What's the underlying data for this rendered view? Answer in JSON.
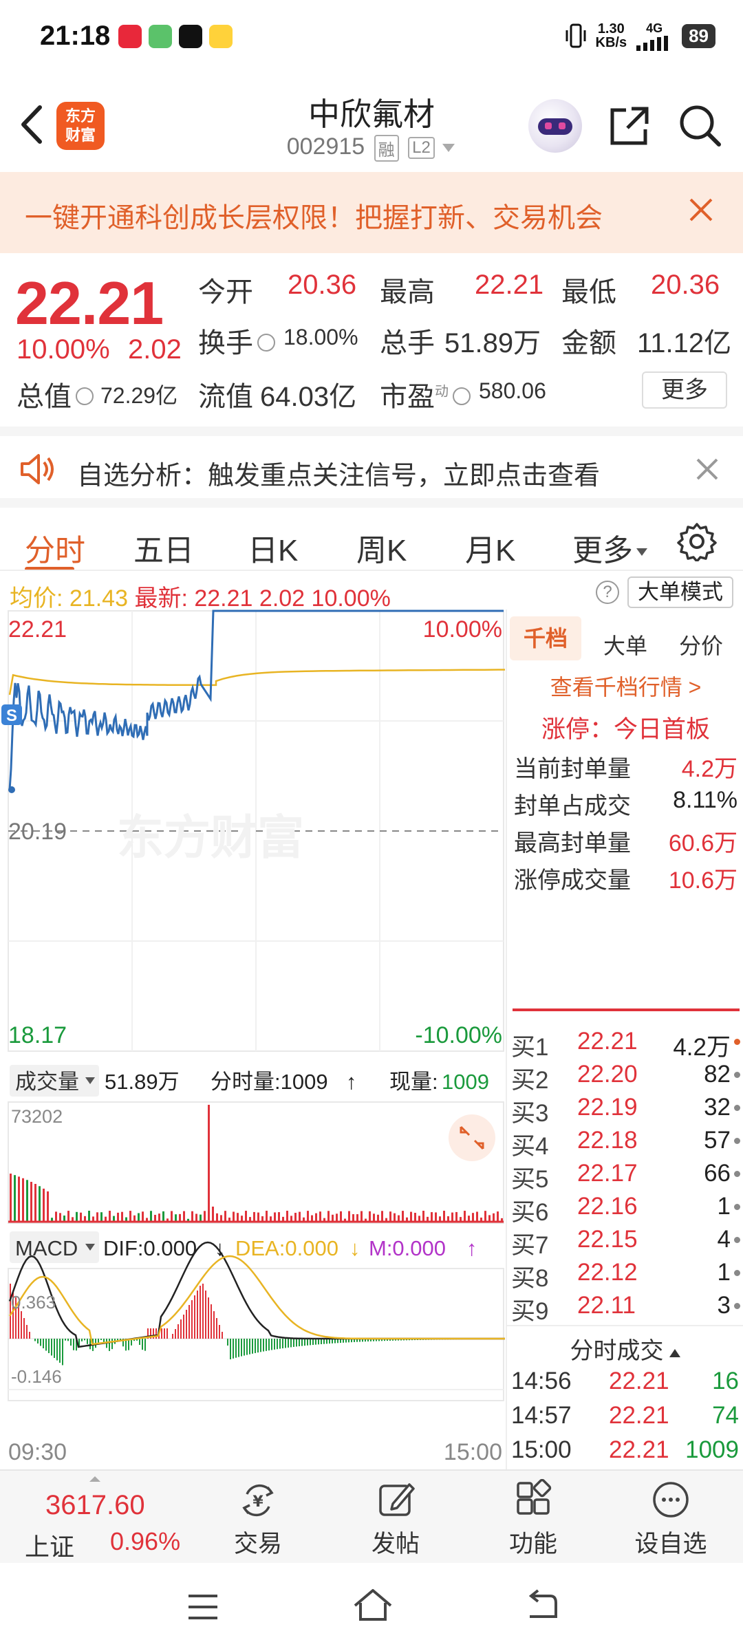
{
  "status_bar": {
    "time": "21:18",
    "net_speed_top": "1.30",
    "net_speed_unit": "KB/s",
    "net_type": "4G",
    "battery": "89"
  },
  "header": {
    "brand_line1": "东方",
    "brand_line2": "财富",
    "stock_name": "中欣氟材",
    "stock_code": "002915",
    "tag_margin": "融",
    "tag_level": "L2"
  },
  "promo": {
    "text": "一键开通科创成长层权限！把握打新、交易机会"
  },
  "quote": {
    "price": "22.21",
    "change_pct": "10.00%",
    "change_val": "2.02",
    "open_label": "今开",
    "open": "20.36",
    "high_label": "最高",
    "high": "22.21",
    "low_label": "最低",
    "low": "20.36",
    "turnover_label": "换手",
    "turnover": "18.00%",
    "volume_label": "总手",
    "volume": "51.89万",
    "amount_label": "金额",
    "amount": "11.12亿",
    "total_value_label": "总值",
    "total_value": "72.29亿",
    "float_value_label": "流值",
    "float_value": "64.03亿",
    "pe_label": "市盈",
    "pe_sup": "动",
    "pe": "580.06",
    "more": "更多"
  },
  "notice": {
    "text": "自选分析：触发重点关注信号，立即点击查看"
  },
  "tabs": [
    {
      "label": "分时"
    },
    {
      "label": "五日"
    },
    {
      "label": "日K"
    },
    {
      "label": "周K"
    },
    {
      "label": "月K"
    },
    {
      "label": "更多"
    }
  ],
  "avg_row": {
    "avg_label": "均价:",
    "avg_value": "21.43",
    "latest_label": "最新:",
    "latest_value": "22.21",
    "latest_change": "2.02",
    "latest_pct": "10.00%",
    "help": "?",
    "big_order_mode": "大单模式"
  },
  "chart": {
    "top_price": "22.21",
    "top_pct": "10.00%",
    "mid_price": "20.19",
    "bottom_price": "18.17",
    "bottom_pct": "-10.00%",
    "marker": "S",
    "watermark": "东方财富",
    "vol_selector": "成交量",
    "vol_total": "51.89万",
    "tick_vol_label": "分时量:1009",
    "tick_vol_arrow": "↑",
    "now_vol_label": "现量:",
    "now_vol": "1009",
    "vol_max": "73202",
    "macd_selector": "MACD",
    "dif": "DIF:0.000",
    "dif_arrow": "↓",
    "dea": "DEA:0.000",
    "dea_arrow": "↓",
    "m": "M:0.000",
    "m_arrow": "↑",
    "macd_max": "0.363",
    "macd_min": "-0.146",
    "time_start": "09:30",
    "time_end": "15:00",
    "colors": {
      "price_line": "#2f6db5",
      "avg_line": "#e8b423",
      "up": "#e0323a",
      "down": "#1a9a3c"
    }
  },
  "right_panel": {
    "tabs": [
      "千档",
      "大单",
      "分价"
    ],
    "view_1000": "查看千档行情 >",
    "limit_up": "涨停：今日首板",
    "stats": [
      {
        "label": "当前封单量",
        "value": "4.2万"
      },
      {
        "label": "封单占成交",
        "value": "8.11%"
      },
      {
        "label": "最高封单量",
        "value": "60.6万"
      },
      {
        "label": "涨停成交量",
        "value": "10.6万"
      }
    ],
    "bids": [
      {
        "label": "买1",
        "price": "22.21",
        "vol": "4.2万"
      },
      {
        "label": "买2",
        "price": "22.20",
        "vol": "82"
      },
      {
        "label": "买3",
        "price": "22.19",
        "vol": "32"
      },
      {
        "label": "买4",
        "price": "22.18",
        "vol": "57"
      },
      {
        "label": "买5",
        "price": "22.17",
        "vol": "66"
      },
      {
        "label": "买6",
        "price": "22.16",
        "vol": "1"
      },
      {
        "label": "买7",
        "price": "22.15",
        "vol": "4"
      },
      {
        "label": "买8",
        "price": "22.12",
        "vol": "1"
      },
      {
        "label": "买9",
        "price": "22.11",
        "vol": "3"
      }
    ],
    "ticks_title": "分时成交",
    "ticks": [
      {
        "time": "14:56",
        "price": "22.21",
        "vol": "16"
      },
      {
        "time": "14:57",
        "price": "22.21",
        "vol": "74"
      },
      {
        "time": "15:00",
        "price": "22.21",
        "vol": "1009"
      }
    ]
  },
  "bottom_bar": {
    "index_value": "3617.60",
    "index_name": "上证",
    "index_pct": "0.96%",
    "nav": [
      {
        "label": "交易",
        "icon": "trade-icon"
      },
      {
        "label": "发帖",
        "icon": "post-icon"
      },
      {
        "label": "功能",
        "icon": "function-icon"
      },
      {
        "label": "设自选",
        "icon": "add-watchlist-icon"
      }
    ]
  }
}
